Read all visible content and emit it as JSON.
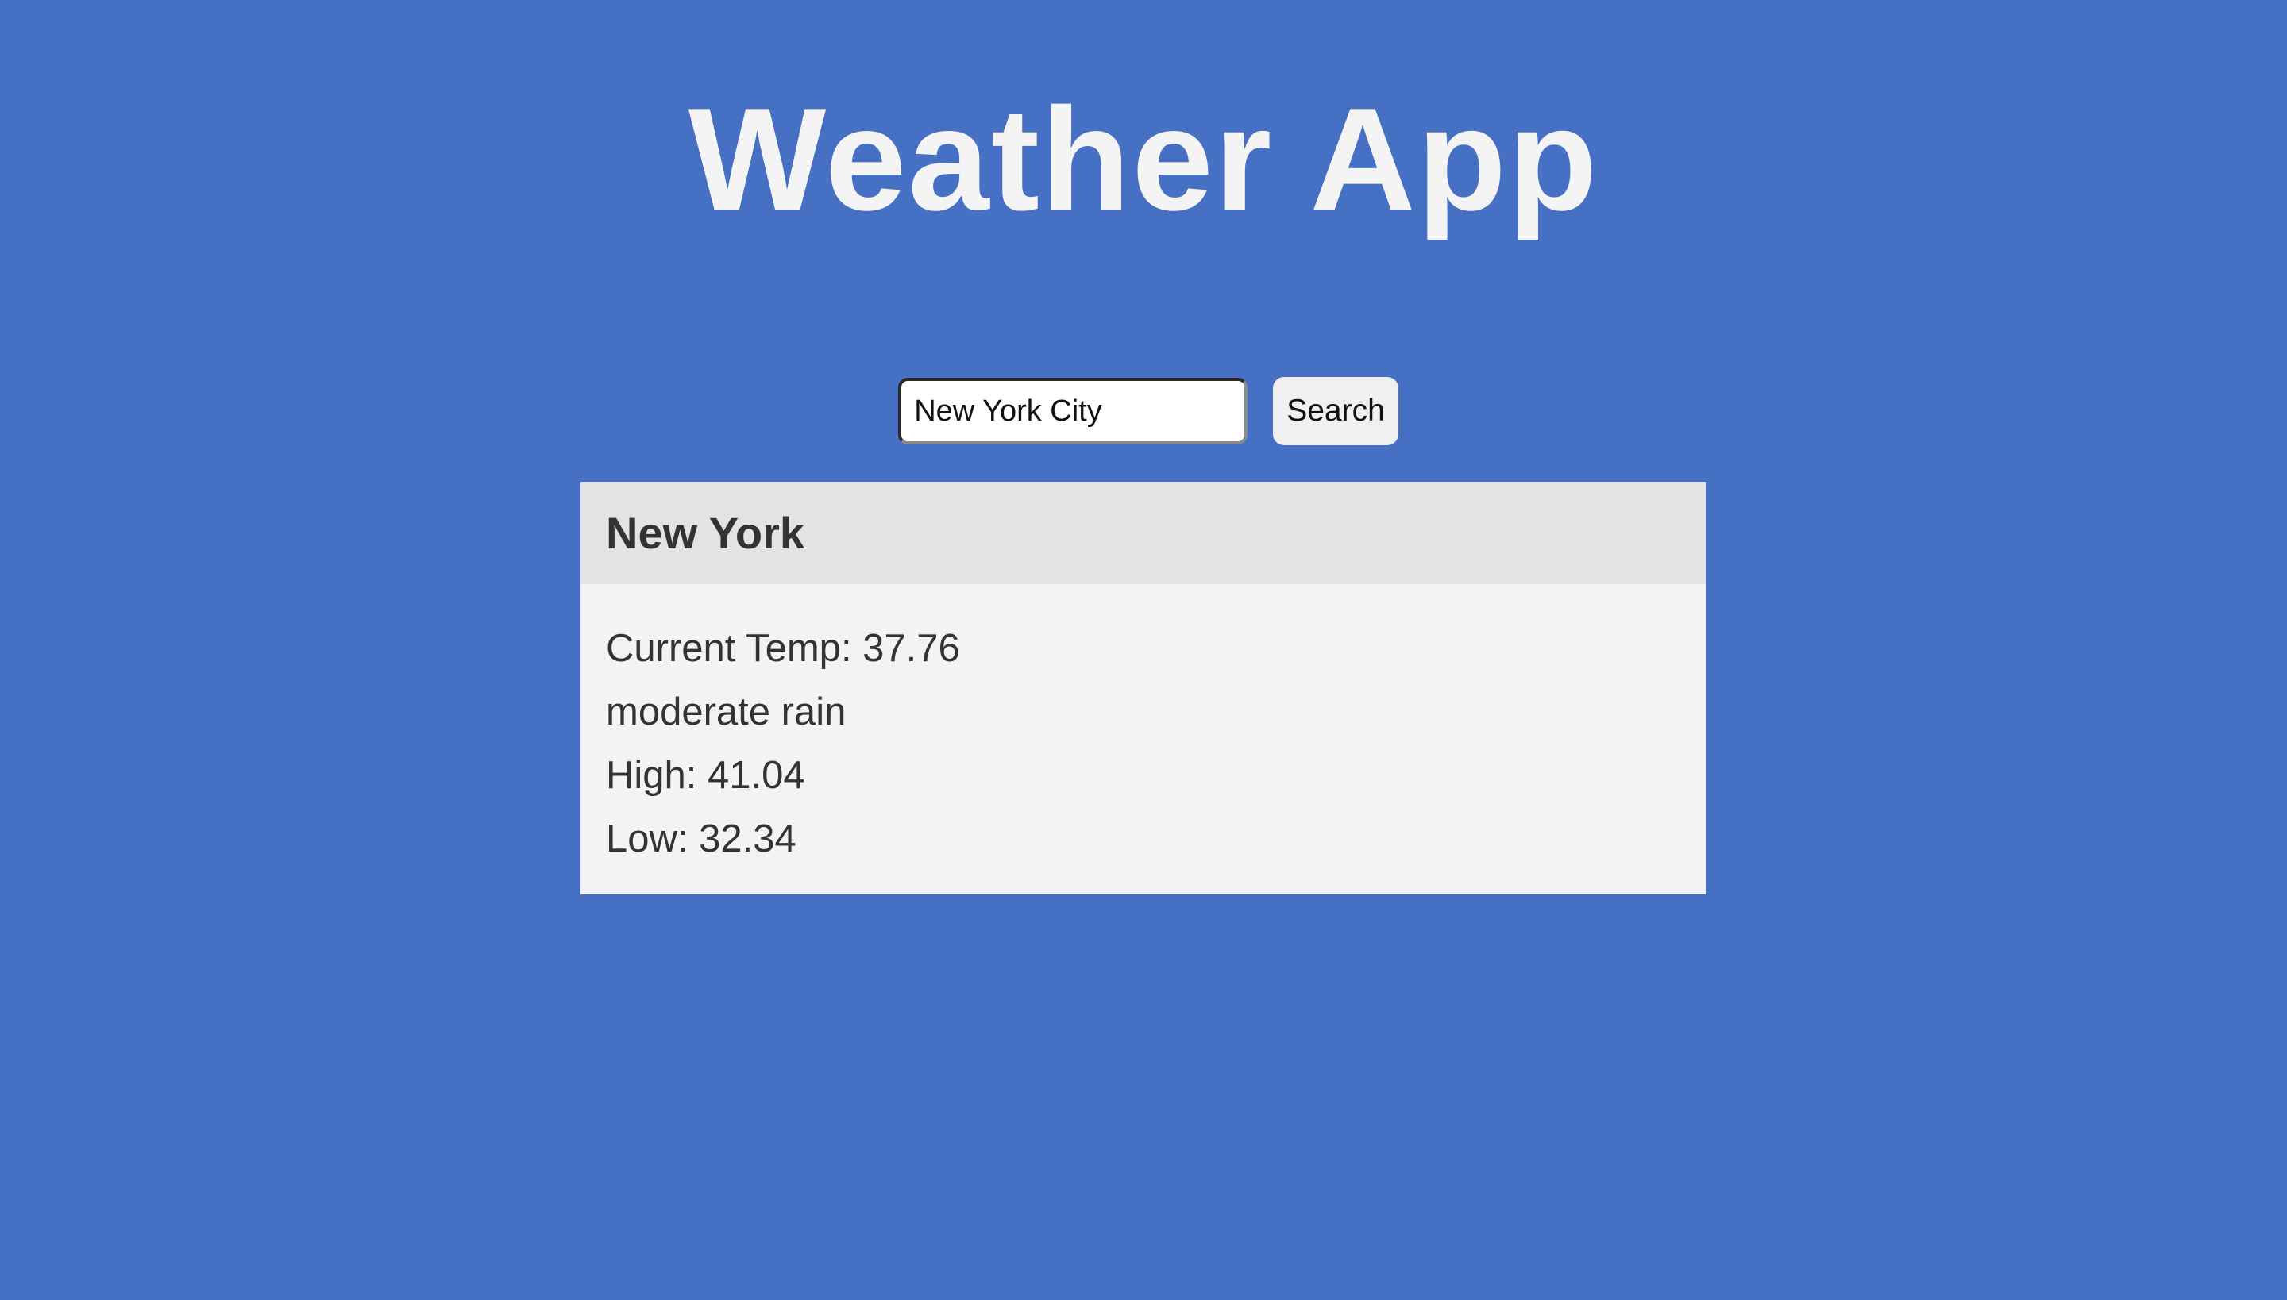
{
  "app": {
    "title": "Weather App"
  },
  "search": {
    "value": "New York City",
    "button_label": "Search"
  },
  "weather": {
    "city": "New York",
    "current_temp": "Current Temp: 37.76",
    "description": "moderate rain",
    "high": "High: 41.04",
    "low": "Low: 32.34"
  },
  "colors": {
    "background": "#4570c3",
    "card_header": "#e3e3e3",
    "card_body": "#f3f3f3",
    "title_text": "#f4f4f4",
    "card_text": "#333333"
  }
}
